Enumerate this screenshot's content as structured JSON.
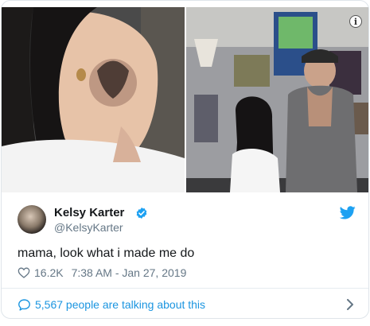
{
  "tweet": {
    "author_name": "Kelsy Karter",
    "author_handle": "@KelsyKarter",
    "text": "mama, look what i made me do",
    "likes": "16.2K",
    "timestamp": "7:38 AM - Jan 27, 2019",
    "footer_text": "5,567 people are talking about this"
  },
  "icons": {
    "info": "info-icon",
    "verified": "verified-badge-icon",
    "brand": "twitter-bird-icon",
    "like": "heart-icon",
    "conversation": "speech-bubble-icon",
    "more": "chevron-right-icon"
  },
  "colors": {
    "accent": "#1b95e0",
    "verified": "#1da1f2",
    "secondary_text": "#657786",
    "primary_text": "#14171a"
  }
}
